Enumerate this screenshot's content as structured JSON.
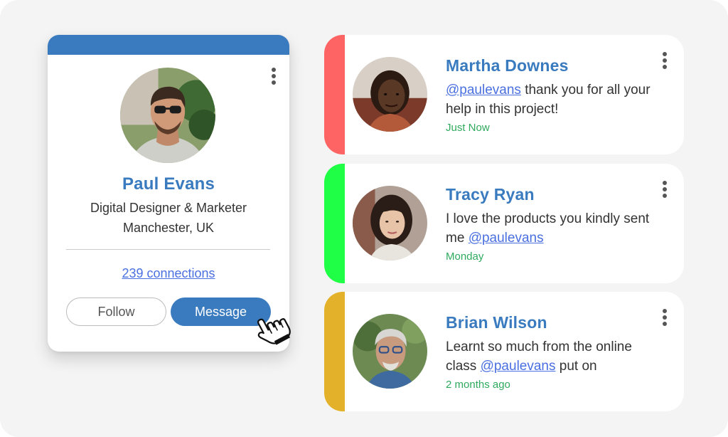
{
  "profile": {
    "name": "Paul Evans",
    "title": "Digital Designer & Marketer",
    "location": "Manchester, UK",
    "connections_label": "239 connections",
    "follow_label": "Follow",
    "message_label": "Message",
    "accent_color": "#3a7bbf"
  },
  "messages": [
    {
      "name": "Martha Downes",
      "text_before": "",
      "mention": "@paulevans",
      "text_after": " thank you for all your help in this project!",
      "time": "Just Now",
      "bar_color": "#ff6464"
    },
    {
      "name": "Tracy Ryan",
      "text_before": "I love the products you kindly sent me ",
      "mention": "@paulevans",
      "text_after": "",
      "time": "Monday",
      "bar_color": "#1eff46"
    },
    {
      "name": "Brian Wilson",
      "text_before": "Learnt so much from the online class ",
      "mention": "@paulevans",
      "text_after": " put on",
      "time": "2 months ago",
      "bar_color": "#e3b22a"
    }
  ],
  "colors": {
    "link": "#4a6fe0",
    "timestamp": "#2eaa5e",
    "name": "#3a7bbf"
  },
  "icons": {
    "more_menu": "more-vertical-icon",
    "cursor": "hand-pointer-icon"
  }
}
